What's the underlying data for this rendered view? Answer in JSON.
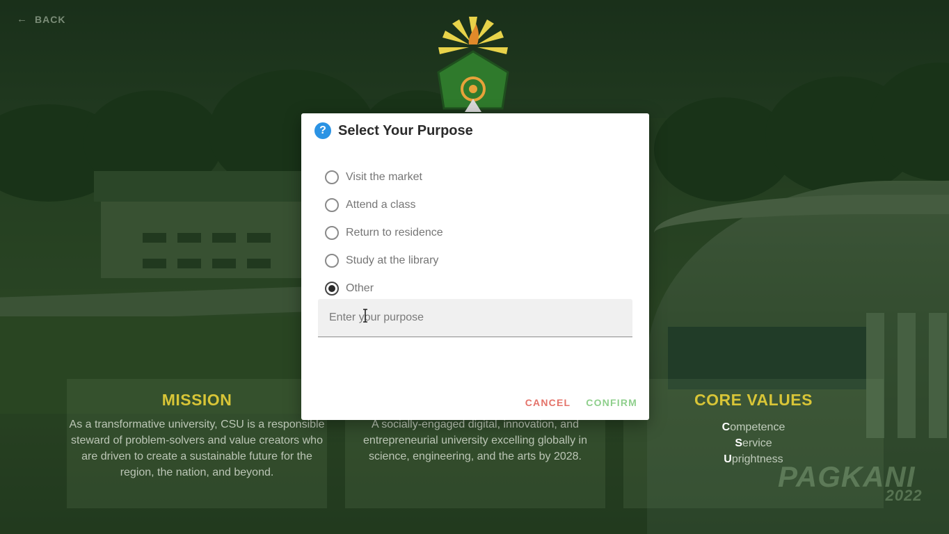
{
  "nav": {
    "back_label": "BACK",
    "back_icon": "arrow-left-icon"
  },
  "logo": {
    "name": "university-seal-logo"
  },
  "cards": {
    "mission": {
      "title": "MISSION",
      "text": "As a transformative university, CSU is a responsible steward of problem-solvers and value creators who are driven to create a sustainable future for the region, the nation, and beyond."
    },
    "vision": {
      "text": "A socially-engaged digital, innovation, and entrepreneurial university excelling globally in science, engineering, and the arts by 2028."
    },
    "core": {
      "title": "CORE VALUES",
      "values": [
        {
          "initial": "C",
          "rest": "ompetence"
        },
        {
          "initial": "S",
          "rest": "ervice"
        },
        {
          "initial": "U",
          "rest": "prightness"
        }
      ]
    }
  },
  "watermark": {
    "text": "PAGKANI",
    "year": "2022"
  },
  "dialog": {
    "title": "Select Your Purpose",
    "icon": "help-icon",
    "options": [
      {
        "label": "Visit the market",
        "checked": false
      },
      {
        "label": "Attend a class",
        "checked": false
      },
      {
        "label": "Return to residence",
        "checked": false
      },
      {
        "label": "Study at the library",
        "checked": false
      },
      {
        "label": "Other",
        "checked": true
      }
    ],
    "purpose_input": {
      "placeholder": "Enter your purpose",
      "value": ""
    },
    "cancel_label": "CANCEL",
    "confirm_label": "CONFIRM"
  },
  "colors": {
    "accent_gold": "#d8c537",
    "help_icon_blue": "#2b93e4",
    "cancel_red": "#e4736a",
    "confirm_green": "#8fcf8c"
  }
}
